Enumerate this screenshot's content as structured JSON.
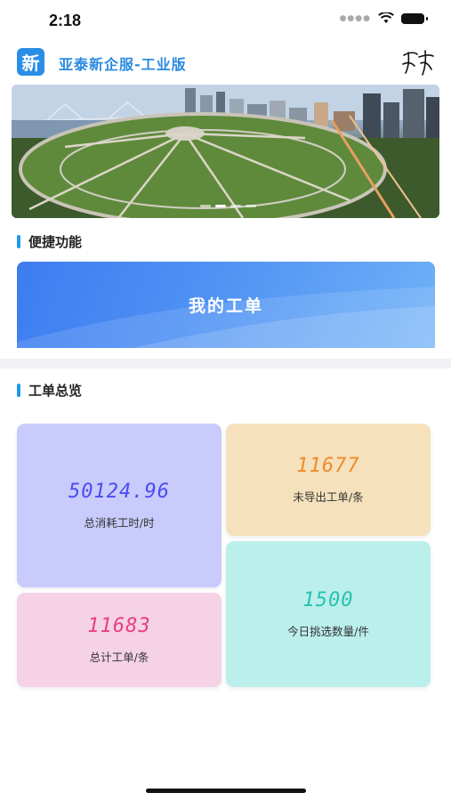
{
  "status_bar": {
    "time": "2:18"
  },
  "header": {
    "logo_char": "新",
    "title": "亚泰新企服-工业版"
  },
  "banner": {
    "dot_count": 4,
    "active_index": 1
  },
  "quick_functions": {
    "title": "便捷功能",
    "my_orders_label": "我的工单"
  },
  "overview": {
    "title": "工单总览",
    "cards": [
      {
        "value": "50124.96",
        "label": "总消耗工时/时"
      },
      {
        "value": "11677",
        "label": "未导出工单/条"
      },
      {
        "value": "11683",
        "label": "总计工单/条"
      },
      {
        "value": "1500",
        "label": "今日挑选数量/件"
      }
    ]
  },
  "colors": {
    "accent": "#1e9be8",
    "title_blue": "#2b8ae0",
    "card1_bg": "#c8cbfb",
    "card1_text": "#4a4cf0",
    "card2_bg": "#f5e1bb",
    "card2_text": "#f08a2a",
    "card3_bg": "#f5d2e6",
    "card3_text": "#e8407e",
    "card4_bg": "#bbefec",
    "card4_text": "#27c2b3"
  }
}
